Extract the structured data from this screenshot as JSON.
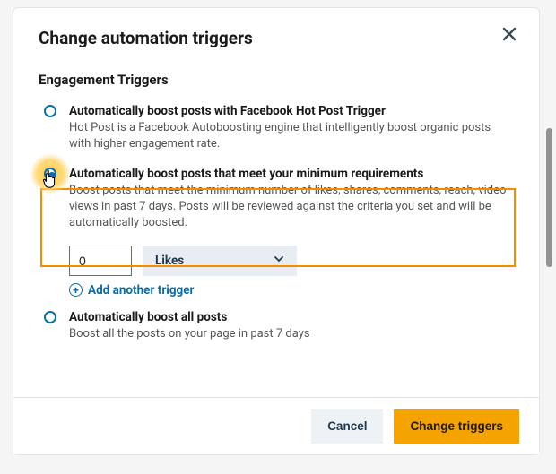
{
  "dialog": {
    "title": "Change automation triggers",
    "section_title": "Engagement Triggers"
  },
  "options": {
    "hotpost": {
      "title": "Automatically boost posts with Facebook Hot Post Trigger",
      "desc": "Hot Post is a Facebook Autoboosting engine that intelligently boost organic posts with higher engagement rate."
    },
    "minreq": {
      "title": "Automatically boost posts that meet your minimum requirements",
      "desc": "Boost posts that meet the minimum number of likes, shares, comments, reach, video views in past 7 days. Posts will be reviewed against the criteria you set and will be automatically boosted."
    },
    "all": {
      "title": "Automatically boost all posts",
      "desc": "Boost all the posts on your page in past 7 days"
    }
  },
  "criteria": {
    "count_value": "0",
    "metric_selected": "Likes",
    "add_trigger_label": "Add another trigger"
  },
  "footer": {
    "cancel": "Cancel",
    "primary": "Change triggers"
  }
}
